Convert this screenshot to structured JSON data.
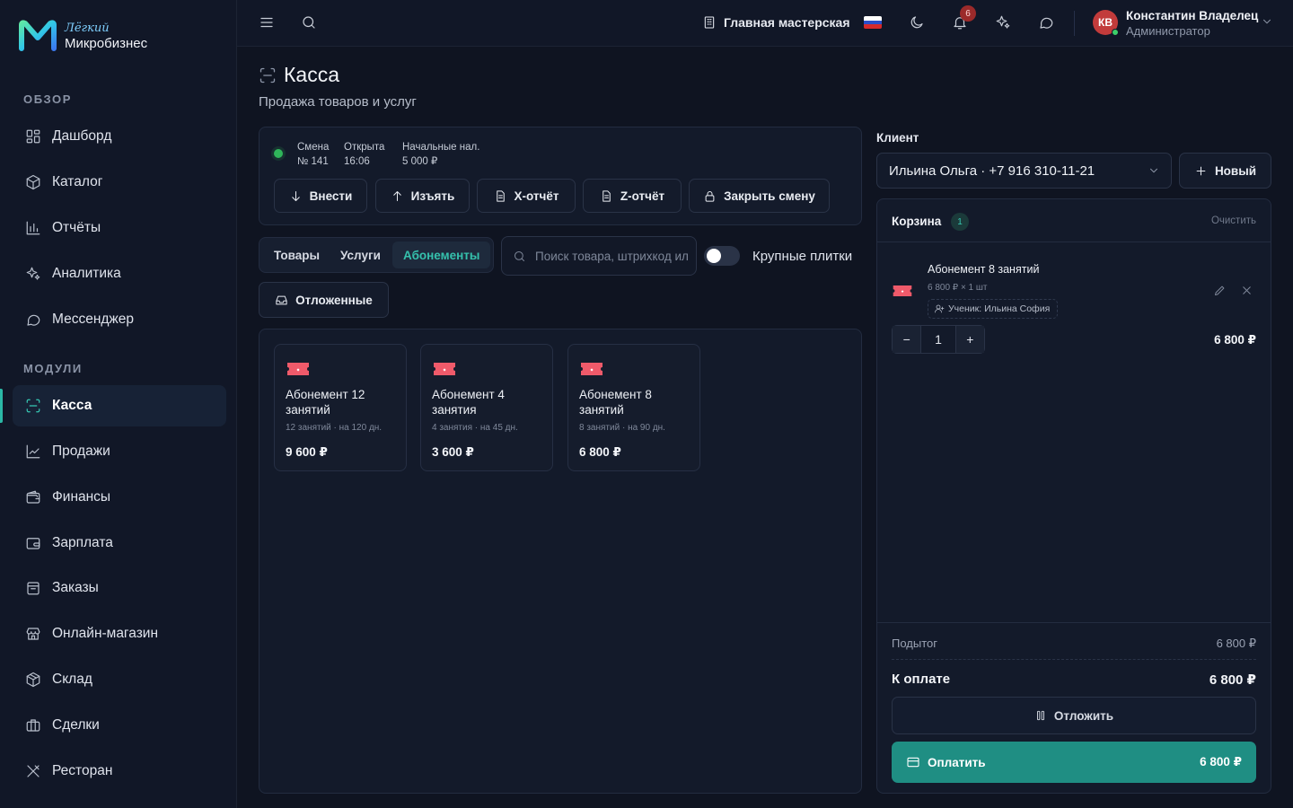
{
  "brand": {
    "line1": "Лёгкий",
    "line2": "Микробизнес"
  },
  "sidebar": {
    "section_overview": "ОБЗОР",
    "section_modules": "МОДУЛИ",
    "items": [
      {
        "label": "Дашборд",
        "icon": "dashboard-icon"
      },
      {
        "label": "Каталог",
        "icon": "catalog-icon"
      },
      {
        "label": "Отчёты",
        "icon": "reports-icon"
      },
      {
        "label": "Аналитика",
        "icon": "sparkles-icon"
      },
      {
        "label": "Мессенджер",
        "icon": "chat-icon"
      },
      {
        "label": "Касса",
        "icon": "scan-icon",
        "active": true
      },
      {
        "label": "Продажи",
        "icon": "line-chart-icon"
      },
      {
        "label": "Финансы",
        "icon": "wallet-icon"
      },
      {
        "label": "Зарплата",
        "icon": "wallet-icon"
      },
      {
        "label": "Заказы",
        "icon": "box-icon"
      },
      {
        "label": "Онлайн-магазин",
        "icon": "store-icon"
      },
      {
        "label": "Склад",
        "icon": "package-icon"
      },
      {
        "label": "Сделки",
        "icon": "briefcase-icon"
      },
      {
        "label": "Ресторан",
        "icon": "utensils-icon"
      }
    ]
  },
  "topbar": {
    "workshop": "Главная мастерская",
    "notifications_count": "6",
    "user": {
      "initials": "КВ",
      "name": "Константин Владелец",
      "role": "Администратор"
    }
  },
  "page": {
    "title": "Касса",
    "subtitle": "Продажа товаров и услуг"
  },
  "shift": {
    "col1_label": "Смена",
    "col1_value": "№ 141",
    "col2_label": "Открыта",
    "col2_value": "16:06",
    "col3_label": "Начальные нал.",
    "col3_value": "5 000 ₽",
    "status_color": "#2fb55a",
    "buttons": {
      "deposit": "Внести",
      "withdraw": "Изъять",
      "x_report": "X-отчёт",
      "z_report": "Z-отчёт",
      "close_shift": "Закрыть смену"
    }
  },
  "catalog": {
    "tabs": [
      "Товары",
      "Услуги",
      "Абонементы"
    ],
    "active_tab": "Абонементы",
    "search_placeholder": "Поиск товара, штрихкод или SKU",
    "large_tiles_label": "Крупные плитки",
    "large_tiles_on": false,
    "deferred_label": "Отложенные",
    "products": [
      {
        "name": "Абонемент 12 занятий",
        "meta": "12 занятий · на 120 дн.",
        "price": "9 600 ₽"
      },
      {
        "name": "Абонемент 4 занятия",
        "meta": "4 занятия · на 45 дн.",
        "price": "3 600 ₽"
      },
      {
        "name": "Абонемент 8 занятий",
        "meta": "8 занятий · на 90 дн.",
        "price": "6 800 ₽"
      }
    ]
  },
  "client": {
    "label": "Клиент",
    "selected": "Ильина Ольга · +7 916 310-11-21",
    "new_label": "Новый"
  },
  "cart": {
    "title": "Корзина",
    "count": "1",
    "clear_label": "Очистить",
    "item": {
      "name": "Абонемент 8 занятий",
      "sub": "6 800 ₽ × 1 шт",
      "student": "Ученик: Ильина София",
      "qty": "1",
      "total": "6 800 ₽"
    },
    "subtotal_label": "Подытог",
    "subtotal_value": "6 800 ₽",
    "pay_label": "К оплате",
    "pay_value": "6 800 ₽",
    "defer_label": "Отложить",
    "pay_button_label": "Оплатить",
    "pay_button_amount": "6 800 ₽"
  },
  "colors": {
    "accent": "#2bb8a6",
    "pay_button": "#1f8e83",
    "ticket": "#ef5a6a",
    "background": "#0f1421"
  }
}
